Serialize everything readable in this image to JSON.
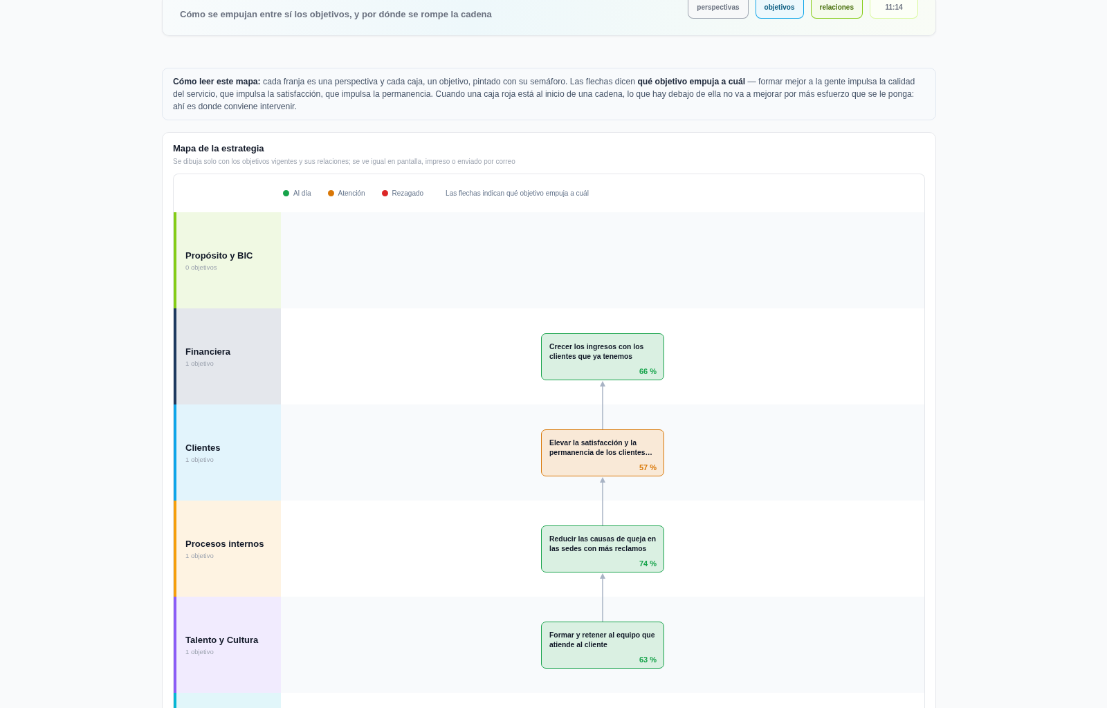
{
  "header": {
    "subtitle": "Cómo se empujan entre sí los objetivos, y por dónde se rompe la cadena",
    "stats": [
      {
        "label": "perspectivas",
        "color": "#9ca3af"
      },
      {
        "label": "objetivos",
        "color": "#0ea5e9"
      },
      {
        "label": "relaciones",
        "color": "#84cc16"
      },
      {
        "label": "11:14",
        "color": "#d9f99d"
      }
    ]
  },
  "intro": {
    "text": "**Cómo leer este mapa:** cada franja es una perspectiva y cada caja, un objetivo, pintado con su semáforo. Las flechas dicen **qué objetivo empuja a cuál** — formar mejor a la gente impulsa la calidad del servicio, que impulsa la satisfacción, que impulsa la permanencia. Cuando una caja roja está al inicio de una cadena, lo que hay debajo de ella no va a mejorar por más esfuerzo que se le ponga: ahí es donde conviene intervenir."
  },
  "map": {
    "title": "Mapa de la estrategia",
    "subtitle": "Se dibuja solo con los objetivos vigentes y sus relaciones; se ve igual en pantalla, impreso o enviado por correo",
    "legend": [
      {
        "label": "Al día",
        "color": "#16a34a"
      },
      {
        "label": "Atención",
        "color": "#d97706"
      },
      {
        "label": "Rezagado",
        "color": "#dc2626"
      }
    ],
    "legend_note": "Las flechas indican qué objetivo empuja a cuál",
    "lanes": [
      {
        "name": "Propósito y BIC",
        "count": "0 objetivos",
        "color": "#84cc16"
      },
      {
        "name": "Financiera",
        "count": "1 objetivo",
        "color": "#1e3a5f",
        "objectives": [
          {
            "title": "Crecer los ingresos con los clientes que ya tenemos",
            "progress": "66 %",
            "color": "#16a34a",
            "pushes_up": false
          }
        ]
      },
      {
        "name": "Clientes",
        "count": "1 objetivo",
        "color": "#0ea5e9",
        "objectives": [
          {
            "title": "Elevar la satisfacción y la permanencia de los clientes…",
            "progress": "57 %",
            "color": "#d97706",
            "pushes_up": true
          }
        ]
      },
      {
        "name": "Procesos internos",
        "count": "1 objetivo",
        "color": "#f59e0b",
        "objectives": [
          {
            "title": "Reducir las causas de queja en las sedes con más reclamos",
            "progress": "74 %",
            "color": "#16a34a",
            "pushes_up": true
          }
        ]
      },
      {
        "name": "Talento y Cultura",
        "count": "1 objetivo",
        "color": "#8b5cf6",
        "objectives": [
          {
            "title": "Formar y retener al equipo que atiende al cliente",
            "progress": "63 %",
            "color": "#16a34a",
            "pushes_up": true
          }
        ]
      },
      {
        "color": "#06b6d4"
      }
    ]
  }
}
